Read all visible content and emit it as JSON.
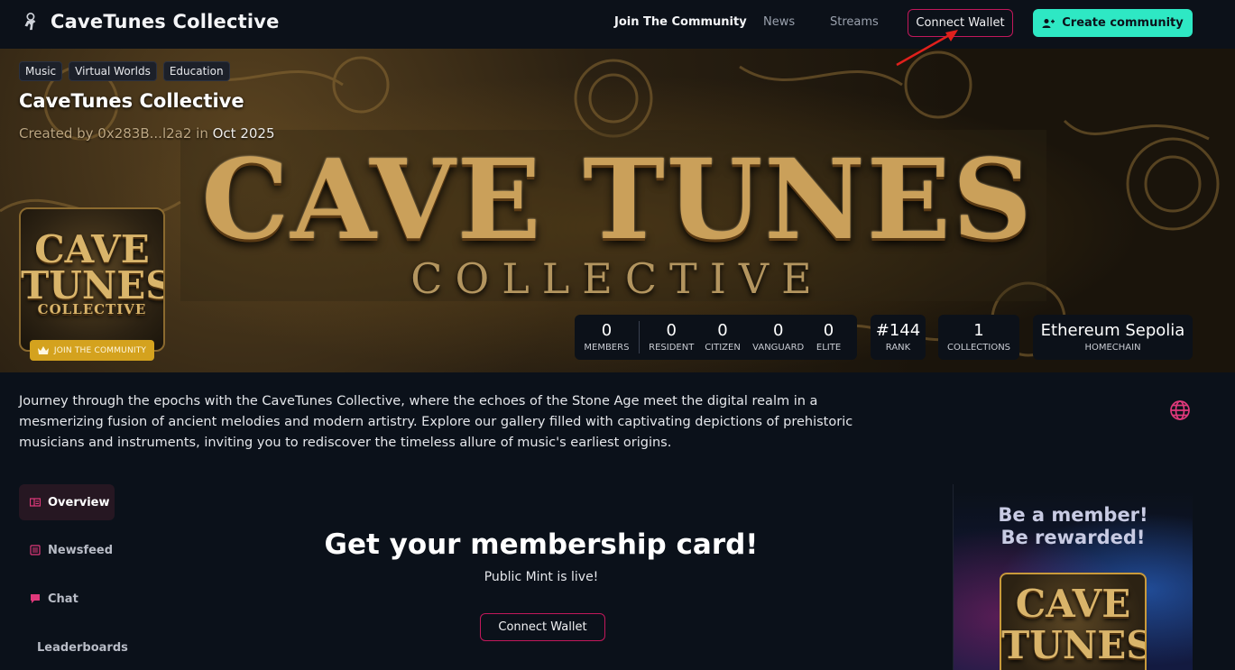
{
  "header": {
    "brand_title": "CaveTunes Collective",
    "nav": {
      "join": "Join The Community",
      "news": "News",
      "streams": "Streams"
    },
    "connect_wallet": "Connect Wallet",
    "create_community": "Create community"
  },
  "banner": {
    "title": "CAVE TUNES",
    "subtitle": "COLLECTIVE"
  },
  "community": {
    "tags": [
      "Music",
      "Virtual Worlds",
      "Education"
    ],
    "title": "CaveTunes Collective",
    "created_prefix": "Created by 0x283B...l2a2 in ",
    "created_date": "Oct 2025",
    "avatar_line1": "CAVE",
    "avatar_line2": "TUNES",
    "avatar_line3": "COLLECTIVE",
    "join_label": "JOIN THE COMMUNITY"
  },
  "stats": {
    "members": {
      "value": "0",
      "label": "MEMBERS"
    },
    "resident": {
      "value": "0",
      "label": "RESIDENT"
    },
    "citizen": {
      "value": "0",
      "label": "CITIZEN"
    },
    "vanguard": {
      "value": "0",
      "label": "VANGUARD"
    },
    "elite": {
      "value": "0",
      "label": "ELITE"
    },
    "rank": {
      "value": "#144",
      "label": "RANK"
    },
    "collections": {
      "value": "1",
      "label": "COLLECTIONS"
    },
    "homechain": {
      "value": "Ethereum Sepolia",
      "label": "HOMECHAIN"
    }
  },
  "description": "Journey through the epochs with the CaveTunes Collective, where the echoes of the Stone Age meet the digital realm in a mesmerizing fusion of ancient melodies and modern artistry. Explore our gallery filled with captivating depictions of prehistoric musicians and instruments, inviting you to rediscover the timeless allure of music's earliest origins.",
  "sidebar": {
    "items": [
      {
        "label": "Overview"
      },
      {
        "label": "Newsfeed"
      },
      {
        "label": "Chat"
      },
      {
        "label": "Leaderboards"
      }
    ]
  },
  "main": {
    "title": "Get your membership card!",
    "subtitle": "Public Mint is live!",
    "connect_wallet": "Connect Wallet"
  },
  "promo": {
    "line1": "Be a member!",
    "line2": "Be rewarded!",
    "card_line1": "CAVE",
    "card_line2": "TUNES"
  },
  "colors": {
    "accent_teal": "#2ee8c4",
    "accent_pink": "#c2185b",
    "gold": "#d4a21e",
    "background": "#0b111a"
  },
  "icons": [
    "astronaut-icon",
    "user-plus-icon",
    "crown-icon",
    "globe-icon",
    "overview-icon",
    "newsfeed-icon",
    "chat-icon",
    "leaderboards-icon"
  ]
}
